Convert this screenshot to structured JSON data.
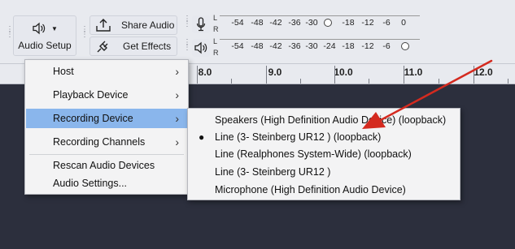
{
  "toolbar": {
    "audio_setup_label": "Audio Setup",
    "share_audio_label": "Share Audio",
    "get_effects_label": "Get Effects",
    "meter_channels": {
      "left": "L",
      "right": "R"
    },
    "recording_scale": [
      "-54",
      "-48",
      "-42",
      "-36",
      "-30",
      "",
      "-18",
      "-12",
      "-6",
      "0"
    ],
    "playback_scale": [
      "-54",
      "-48",
      "-42",
      "-36",
      "-30",
      "-24",
      "-18",
      "-12",
      "-6",
      ""
    ]
  },
  "ruler": {
    "labels": [
      "8.0",
      "9.0",
      "10.0",
      "11.0",
      "12.0"
    ]
  },
  "audio_setup_menu": {
    "items": [
      {
        "label": "Host",
        "submenu": true
      },
      {
        "label": "Playback Device",
        "submenu": true
      },
      {
        "label": "Recording Device",
        "submenu": true,
        "active": true
      },
      {
        "label": "Recording Channels",
        "submenu": true
      },
      {
        "label": "Rescan Audio Devices",
        "submenu": false
      },
      {
        "label": "Audio Settings...",
        "submenu": false
      }
    ]
  },
  "recording_device_menu": {
    "items": [
      {
        "label": "Speakers (High Definition Audio Device) (loopback)",
        "selected": false
      },
      {
        "label": "Line (3- Steinberg UR12 ) (loopback)",
        "selected": true
      },
      {
        "label": "Line (Realphones System-Wide) (loopback)",
        "selected": false
      },
      {
        "label": "Line (3- Steinberg UR12 )",
        "selected": false
      },
      {
        "label": "Microphone (High Definition Audio Device)",
        "selected": false
      }
    ]
  },
  "colors": {
    "annotation_arrow": "#d42a1f",
    "menu_highlight": "#8ab6ec",
    "background": "#2c2f3d"
  }
}
